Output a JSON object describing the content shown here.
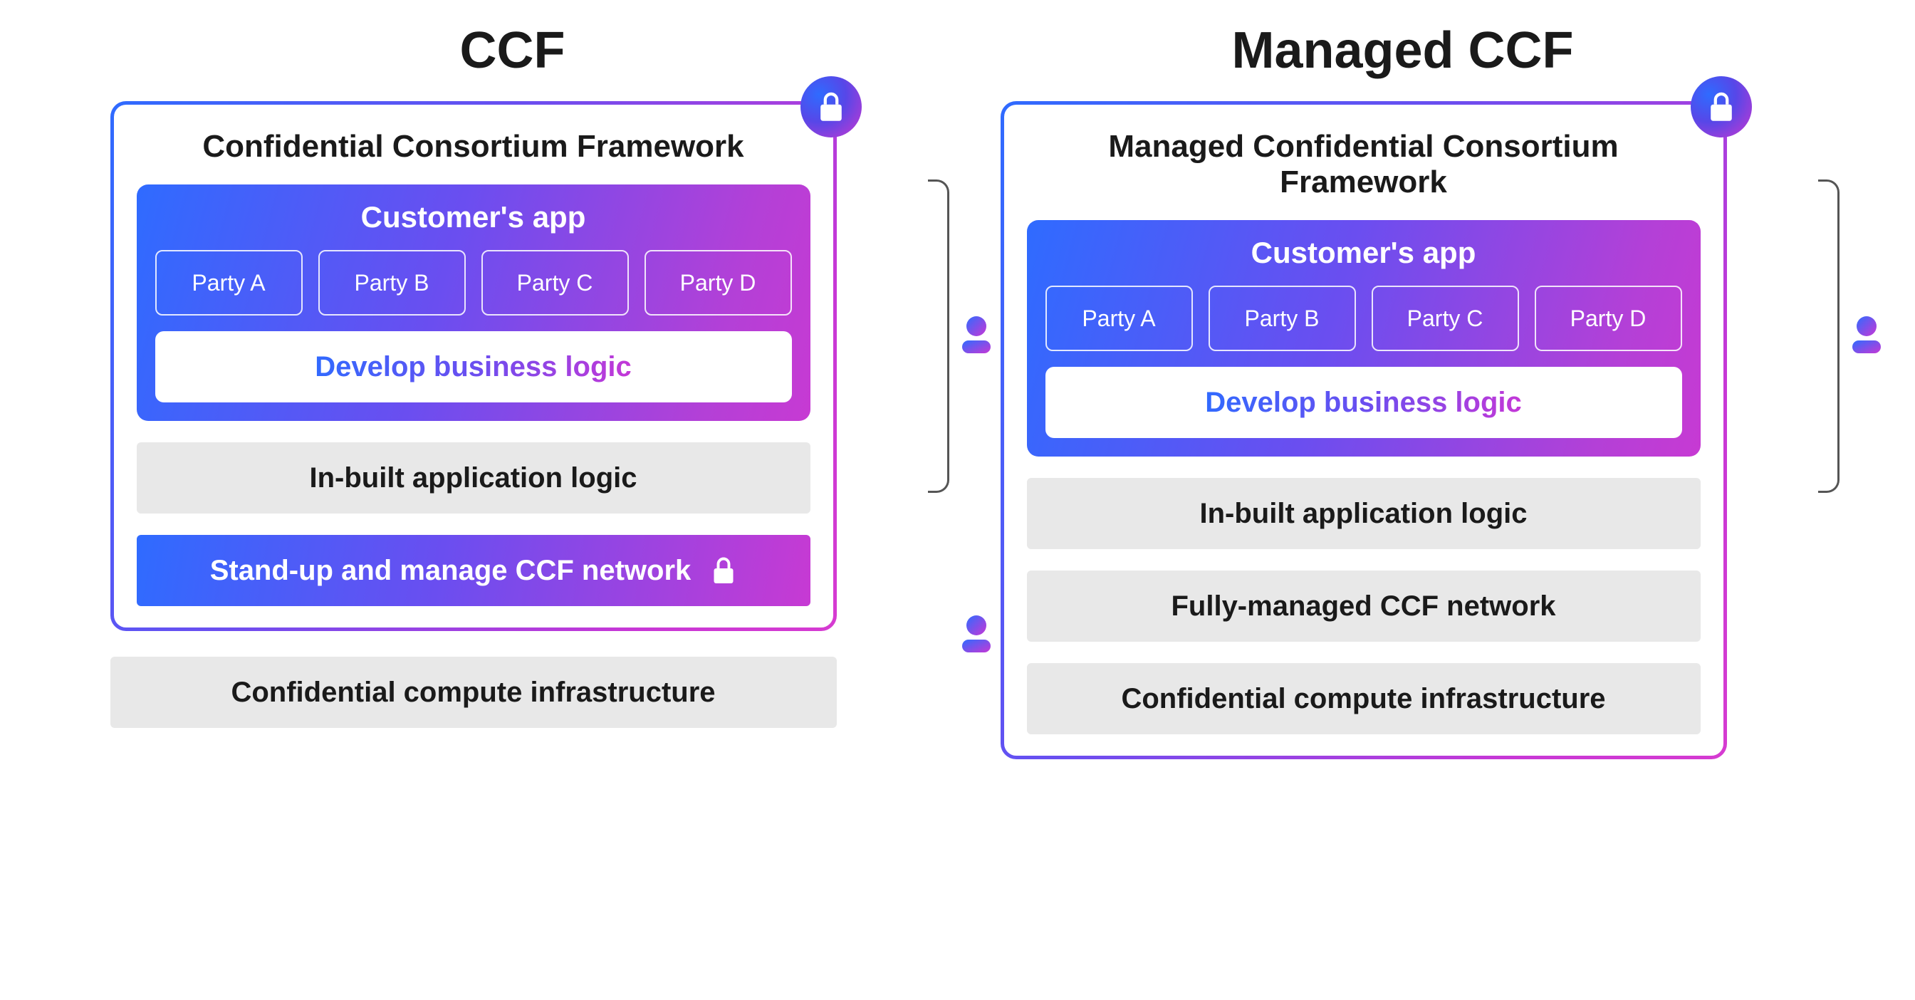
{
  "ccf": {
    "title": "CCF",
    "framework_title": "Confidential Consortium Framework",
    "customer_app_title": "Customer's app",
    "parties": [
      "Party A",
      "Party B",
      "Party C",
      "Party D"
    ],
    "develop_logic": "Develop business logic",
    "inbuilt_logic": "In-built application logic",
    "standup": "Stand-up and manage CCF network",
    "infra": "Confidential compute infrastructure"
  },
  "managed": {
    "title": "Managed CCF",
    "framework_title": "Managed Confidential Consortium Framework",
    "customer_app_title": "Customer's app",
    "parties": [
      "Party A",
      "Party B",
      "Party C",
      "Party D"
    ],
    "develop_logic": "Develop business logic",
    "inbuilt_logic": "In-built application logic",
    "network": "Fully-managed CCF network",
    "infra": "Confidential compute infrastructure"
  }
}
